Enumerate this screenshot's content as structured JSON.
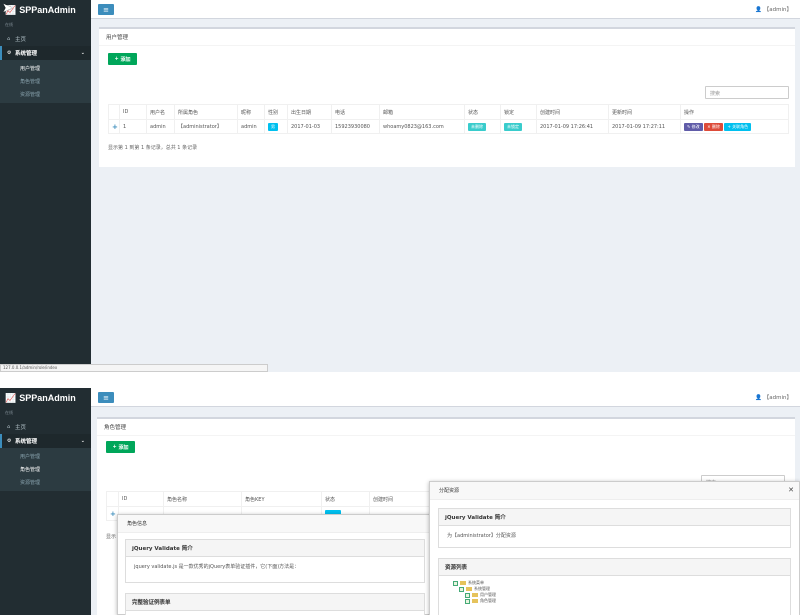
{
  "app": {
    "brand": "SPPanAdmin",
    "admin_label": "【admin】"
  },
  "sidebar": {
    "user_note": "在线",
    "home": "主页",
    "system": "系统管理",
    "items": [
      "用户管理",
      "角色管理",
      "资源管理"
    ]
  },
  "screen1": {
    "box_title": "用户管理",
    "add_label": "添加",
    "search_placeholder": "搜索",
    "columns": [
      "",
      "ID",
      "用户名",
      "所属角色",
      "昵称",
      "性别",
      "出生日期",
      "电话",
      "邮箱",
      "状态",
      "锁定",
      "创建时间",
      "更新时间",
      "操作"
    ],
    "row": {
      "id": "1",
      "username": "admin",
      "role": "【administrator】",
      "nickname": "admin",
      "gender": "男",
      "birth": "2017-01-03",
      "phone": "15923930080",
      "email": "whoamy0823@163.com",
      "status": "未删除",
      "locked": "未锁定",
      "created": "2017-01-09 17:26:41",
      "updated": "2017-01-09 17:27:11",
      "actions": [
        "修改",
        "删除",
        "关联角色"
      ]
    },
    "footer": "显示第 1 到第 1 条记录，总共 1 条记录",
    "status_url": "127.0.0.1/admin/role/index"
  },
  "screen2": {
    "box_title": "角色管理",
    "add_label": "添加",
    "search_placeholder": "搜索",
    "columns": [
      "",
      "ID",
      "角色名称",
      "角色KEY",
      "状态",
      "创建时间"
    ],
    "footer": "显示",
    "dialog_a": {
      "title": "角色信息",
      "panel1_title": "jQuery Validate 简介",
      "panel1_text": "jquery validate.js 是一款优秀的jQuery表单验证插件，它(下面)方法是：",
      "panel2_title": "完整验证例表单"
    },
    "dialog_b": {
      "title": "分配资源",
      "panel1_title": "jQuery Validate 简介",
      "panel1_text": "为【administrator】分配资源",
      "panel2_title": "资源列表",
      "tree": [
        "系统菜单",
        "系统管理",
        "用户管理",
        "角色管理"
      ]
    }
  },
  "colors": {
    "sidebar": "#222d32",
    "accent": "#3c8dbc",
    "green": "#00a65a"
  }
}
